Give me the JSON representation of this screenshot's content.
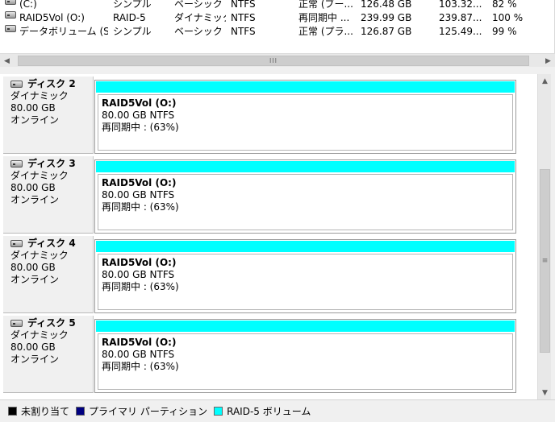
{
  "volumes": [
    {
      "name": "(C:)",
      "layout": "シンプル",
      "type": "ベーシック",
      "fs": "NTFS",
      "status": "正常 (ブー...",
      "capacity": "126.48 GB",
      "free": "103.32...",
      "pct": "82 %"
    },
    {
      "name": "RAID5Vol (O:)",
      "layout": "RAID-5",
      "type": "ダイナミック",
      "fs": "NTFS",
      "status": "再同期中 ...",
      "capacity": "239.99 GB",
      "free": "239.87...",
      "pct": "100 %"
    },
    {
      "name": "データボリューム (S:)",
      "layout": "シンプル",
      "type": "ベーシック",
      "fs": "NTFS",
      "status": "正常 (プラ...",
      "capacity": "126.87 GB",
      "free": "125.49...",
      "pct": "99 %"
    }
  ],
  "hscroll": {
    "left_arrow": "◀",
    "right_arrow": "▶",
    "grip": "III"
  },
  "vscroll": {
    "up_arrow": "▲",
    "down_arrow": "▼",
    "grip": "≡"
  },
  "disks": [
    {
      "title": "ディスク 2",
      "kind": "ダイナミック",
      "size": "80.00 GB",
      "state": "オンライン",
      "partition": {
        "name": "RAID5Vol  (O:)",
        "size_fs": "80.00 GB NTFS",
        "status": "再同期中 : (63%)"
      }
    },
    {
      "title": "ディスク 3",
      "kind": "ダイナミック",
      "size": "80.00 GB",
      "state": "オンライン",
      "partition": {
        "name": "RAID5Vol  (O:)",
        "size_fs": "80.00 GB NTFS",
        "status": "再同期中 : (63%)"
      }
    },
    {
      "title": "ディスク 4",
      "kind": "ダイナミック",
      "size": "80.00 GB",
      "state": "オンライン",
      "partition": {
        "name": "RAID5Vol  (O:)",
        "size_fs": "80.00 GB NTFS",
        "status": "再同期中 : (63%)"
      }
    },
    {
      "title": "ディスク 5",
      "kind": "ダイナミック",
      "size": "80.00 GB",
      "state": "オンライン",
      "partition": {
        "name": "RAID5Vol  (O:)",
        "size_fs": "80.00 GB NTFS",
        "status": "再同期中 : (63%)"
      }
    }
  ],
  "legend": [
    {
      "label": "未割り当て",
      "color": "#000000"
    },
    {
      "label": "プライマリ パーティション",
      "color": "#000080"
    },
    {
      "label": "RAID-5 ボリューム",
      "color": "#00ffff"
    }
  ],
  "colors": {
    "raid5_bar": "#00ffff"
  }
}
